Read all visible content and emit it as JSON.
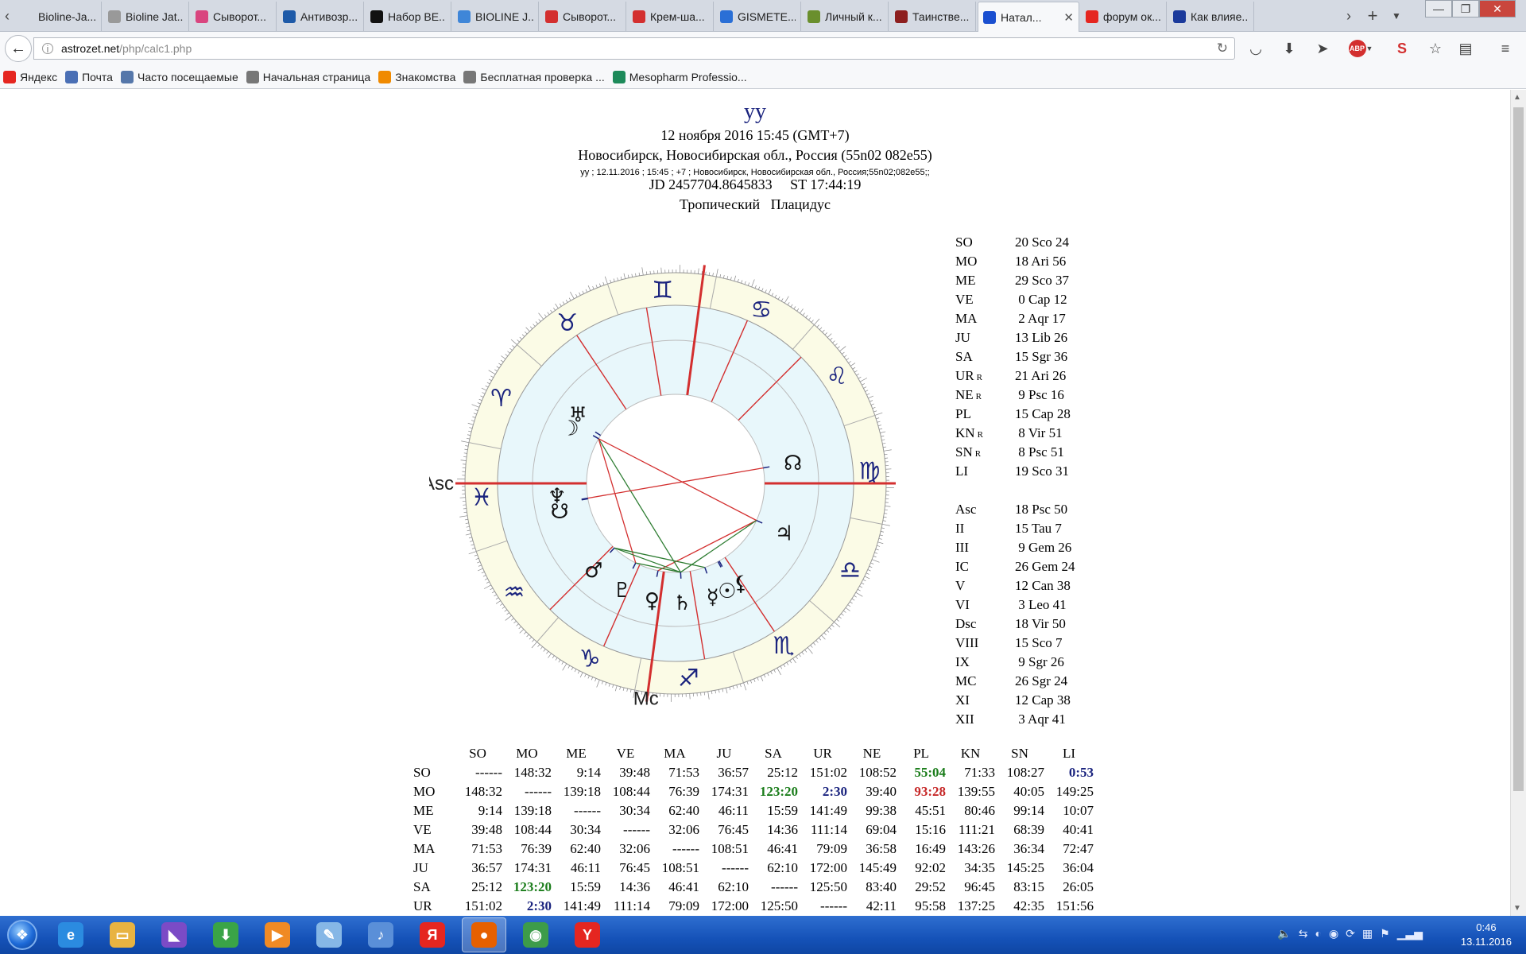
{
  "browser": {
    "tabs": [
      {
        "label": "Bioline-Ja...",
        "icon": "page-icon",
        "color": "#d5dae3"
      },
      {
        "label": "Bioline Jat...",
        "icon": "pen-icon",
        "color": "#999999"
      },
      {
        "label": "Сыворот...",
        "icon": "flower-icon",
        "color": "#d9457f"
      },
      {
        "label": "Антивозр...",
        "icon": "globe-icon",
        "color": "#1e5aa8"
      },
      {
        "label": "Набор BE...",
        "icon": "blob-icon",
        "color": "#111111"
      },
      {
        "label": "BIOLINE J...",
        "icon": "bird-icon",
        "color": "#3f86d8"
      },
      {
        "label": "Сыворот...",
        "icon": "warning-icon",
        "color": "#d32f2f"
      },
      {
        "label": "Крем-ша...",
        "icon": "warning-icon",
        "color": "#d32f2f"
      },
      {
        "label": "GISMETE...",
        "icon": "weather-icon",
        "color": "#2a6fd6"
      },
      {
        "label": "Личный к...",
        "icon": "puzzle-icon",
        "color": "#6a8f2d"
      },
      {
        "label": "Таинстве...",
        "icon": "cross-icon",
        "color": "#8d1f1f"
      },
      {
        "label": "Натал...",
        "icon": "z-icon",
        "color": "#1a4fd0",
        "active": true
      },
      {
        "label": "форум ок...",
        "icon": "yandex-icon",
        "color": "#e52620"
      },
      {
        "label": "Как влияе...",
        "icon": "moon-icon",
        "color": "#1b3a9b"
      }
    ],
    "url_host": "astrozet.net",
    "url_path": "/php/calc1.php",
    "bookmarks": [
      {
        "label": "Яндекс",
        "color": "#e52620"
      },
      {
        "label": "Почта",
        "color": "#4a6fb5"
      },
      {
        "label": "Часто посещаемые",
        "color": "#5577aa"
      },
      {
        "label": "Начальная страница",
        "color": "#777777"
      },
      {
        "label": "Знакомства",
        "color": "#f08a00"
      },
      {
        "label": "Бесплатная проверка ...",
        "color": "#777777"
      },
      {
        "label": "Mesopharm Professio...",
        "color": "#1d8a5a"
      }
    ]
  },
  "chart": {
    "title": "yy",
    "date": "12 ноября 2016 15:45 (GMT+7)",
    "place": "Новосибирск, Новосибирская обл., Россия (55n02 082e55)",
    "raw": "yy ; 12.11.2016 ; 15:45 ; +7 ; Новосибирск, Новосибирская обл., Россия;55n02;082e55;;",
    "jd": "JD 2457704.8645833     ST 17:44:19",
    "system": "Тропический   Плацидус",
    "asc_label": "Asc",
    "mc_label": "Mc",
    "asc_longitude": 348.833,
    "cusps": [
      348.833,
      45.117,
      69.433,
      86.4,
      102.633,
      123.683,
      168.833,
      225.117,
      249.433,
      266.4,
      282.633,
      303.683
    ],
    "signs": [
      "♈",
      "♉",
      "♊",
      "♋",
      "♌",
      "♍",
      "♎",
      "♏",
      "♐",
      "♑",
      "♒",
      "♓"
    ],
    "planets": [
      {
        "glyph": "☉",
        "lon": 230.4
      },
      {
        "glyph": "☽",
        "lon": 18.933
      },
      {
        "glyph": "☿",
        "lon": 239.617
      },
      {
        "glyph": "♀",
        "lon": 270.2
      },
      {
        "glyph": "♂",
        "lon": 302.283
      },
      {
        "glyph": "♃",
        "lon": 193.433
      },
      {
        "glyph": "♄",
        "lon": 255.6
      },
      {
        "glyph": "♅",
        "lon": 21.433
      },
      {
        "glyph": "♆",
        "lon": 339.267
      },
      {
        "glyph": "♇",
        "lon": 285.467
      },
      {
        "glyph": "☊",
        "lon": 158.85
      },
      {
        "glyph": "☋",
        "lon": 338.85
      },
      {
        "glyph": "⚸",
        "lon": 229.517
      }
    ],
    "aspect_lines": [
      {
        "a": 193.433,
        "b": 18.933,
        "color": "#d32f2f"
      },
      {
        "a": 193.433,
        "b": 270.2,
        "color": "#d32f2f"
      },
      {
        "a": 193.433,
        "b": 255.6,
        "color": "#2e7d32"
      },
      {
        "a": 18.933,
        "b": 255.6,
        "color": "#2e7d32"
      },
      {
        "a": 18.933,
        "b": 285.467,
        "color": "#d32f2f"
      },
      {
        "a": 339.267,
        "b": 158.85,
        "color": "#d32f2f"
      },
      {
        "a": 302.283,
        "b": 255.6,
        "color": "#2e7d32"
      },
      {
        "a": 302.283,
        "b": 239.617,
        "color": "#2e7d32"
      },
      {
        "a": 285.467,
        "b": 255.6,
        "color": "#2e7d32"
      }
    ],
    "colors": {
      "outer_ring": "#fbfbe6",
      "inner_ring": "#e8f7fb",
      "sign_glyph": "#1a237e",
      "house_line": "#d32f2f"
    }
  },
  "positions": [
    {
      "name": "SO",
      "value": "20 Sco 24"
    },
    {
      "name": "MO",
      "value": "18 Ari 56"
    },
    {
      "name": "ME",
      "value": "29 Sco 37"
    },
    {
      "name": "VE",
      "value": " 0 Cap 12"
    },
    {
      "name": "MA",
      "value": " 2 Aqr 17"
    },
    {
      "name": "JU",
      "value": "13 Lib 26"
    },
    {
      "name": "SA",
      "value": "15 Sgr 36"
    },
    {
      "name": "UR",
      "retro": "R",
      "value": "21 Ari 26"
    },
    {
      "name": "NE",
      "retro": "R",
      "value": " 9 Psc 16"
    },
    {
      "name": "PL",
      "value": "15 Cap 28"
    },
    {
      "name": "KN",
      "retro": "R",
      "value": " 8 Vir 51"
    },
    {
      "name": "SN",
      "retro": "R",
      "value": " 8 Psc 51"
    },
    {
      "name": "LI",
      "value": "19 Sco 31"
    }
  ],
  "houses": [
    {
      "name": "Asc",
      "value": "18 Psc 50"
    },
    {
      "name": "II",
      "value": "15 Tau 7"
    },
    {
      "name": "III",
      "value": " 9 Gem 26"
    },
    {
      "name": "IC",
      "value": "26 Gem 24"
    },
    {
      "name": "V",
      "value": "12 Can 38"
    },
    {
      "name": "VI",
      "value": " 3 Leo 41"
    },
    {
      "name": "Dsc",
      "value": "18 Vir 50"
    },
    {
      "name": "VIII",
      "value": "15 Sco 7"
    },
    {
      "name": "IX",
      "value": " 9 Sgr 26"
    },
    {
      "name": "MC",
      "value": "26 Sgr 24"
    },
    {
      "name": "XI",
      "value": "12 Cap 38"
    },
    {
      "name": "XII",
      "value": " 3 Aqr 41"
    }
  ],
  "aspects": {
    "columns": [
      "SO",
      "MO",
      "ME",
      "VE",
      "MA",
      "JU",
      "SA",
      "UR",
      "NE",
      "PL",
      "KN",
      "SN",
      "LI"
    ],
    "rows": [
      {
        "name": "SO",
        "cells": [
          "------",
          "148:32",
          "9:14",
          "39:48",
          "71:53",
          "36:57",
          "25:12",
          "151:02",
          "108:52",
          "55:04",
          "71:33",
          "108:27",
          "0:53"
        ]
      },
      {
        "name": "MO",
        "cells": [
          "148:32",
          "------",
          "139:18",
          "108:44",
          "76:39",
          "174:31",
          "123:20",
          "2:30",
          "39:40",
          "93:28",
          "139:55",
          "40:05",
          "149:25"
        ]
      },
      {
        "name": "ME",
        "cells": [
          "9:14",
          "139:18",
          "------",
          "30:34",
          "62:40",
          "46:11",
          "15:59",
          "141:49",
          "99:38",
          "45:51",
          "80:46",
          "99:14",
          "10:07"
        ]
      },
      {
        "name": "VE",
        "cells": [
          "39:48",
          "108:44",
          "30:34",
          "------",
          "32:06",
          "76:45",
          "14:36",
          "111:14",
          "69:04",
          "15:16",
          "111:21",
          "68:39",
          "40:41"
        ]
      },
      {
        "name": "MA",
        "cells": [
          "71:53",
          "76:39",
          "62:40",
          "32:06",
          "------",
          "108:51",
          "46:41",
          "79:09",
          "36:58",
          "16:49",
          "143:26",
          "36:34",
          "72:47"
        ]
      },
      {
        "name": "JU",
        "cells": [
          "36:57",
          "174:31",
          "46:11",
          "76:45",
          "108:51",
          "------",
          "62:10",
          "172:00",
          "145:49",
          "92:02",
          "34:35",
          "145:25",
          "36:04"
        ]
      },
      {
        "name": "SA",
        "cells": [
          "25:12",
          "123:20",
          "15:59",
          "14:36",
          "46:41",
          "62:10",
          "------",
          "125:50",
          "83:40",
          "29:52",
          "96:45",
          "83:15",
          "26:05"
        ]
      },
      {
        "name": "UR",
        "cells": [
          "151:02",
          "2:30",
          "141:49",
          "111:14",
          "79:09",
          "172:00",
          "125:50",
          "------",
          "42:11",
          "95:58",
          "137:25",
          "42:35",
          "151:56"
        ]
      }
    ],
    "highlights": {
      "SO.PL": "green",
      "SO.LI": "navy",
      "MO.SA": "green",
      "MO.UR": "navy",
      "MO.PL": "red",
      "SA.MO": "green",
      "UR.MO": "navy"
    }
  },
  "taskbar": {
    "apps": [
      {
        "icon": "ie-icon",
        "glyph": "e",
        "color": "#2b8be0"
      },
      {
        "icon": "explorer-icon",
        "glyph": "▭",
        "color": "#e8b341"
      },
      {
        "icon": "vs-icon",
        "glyph": "◣",
        "color": "#7b4bc6"
      },
      {
        "icon": "download-icon",
        "glyph": "⬇",
        "color": "#3aa447"
      },
      {
        "icon": "media-icon",
        "glyph": "▶",
        "color": "#f08a24"
      },
      {
        "icon": "notepad-icon",
        "glyph": "✎",
        "color": "#86b7e6"
      },
      {
        "icon": "volume-app-icon",
        "glyph": "♪",
        "color": "#5a8fd8"
      },
      {
        "icon": "yandex-app-icon",
        "glyph": "Я",
        "color": "#e52620"
      },
      {
        "icon": "firefox-icon",
        "glyph": "●",
        "color": "#e66000",
        "active": true
      },
      {
        "icon": "chrome-icon",
        "glyph": "◉",
        "color": "#3d9c4a"
      },
      {
        "icon": "yandex-browser-icon",
        "glyph": "Y",
        "color": "#e52620"
      }
    ],
    "time": "0:46",
    "date": "13.11.2016"
  }
}
